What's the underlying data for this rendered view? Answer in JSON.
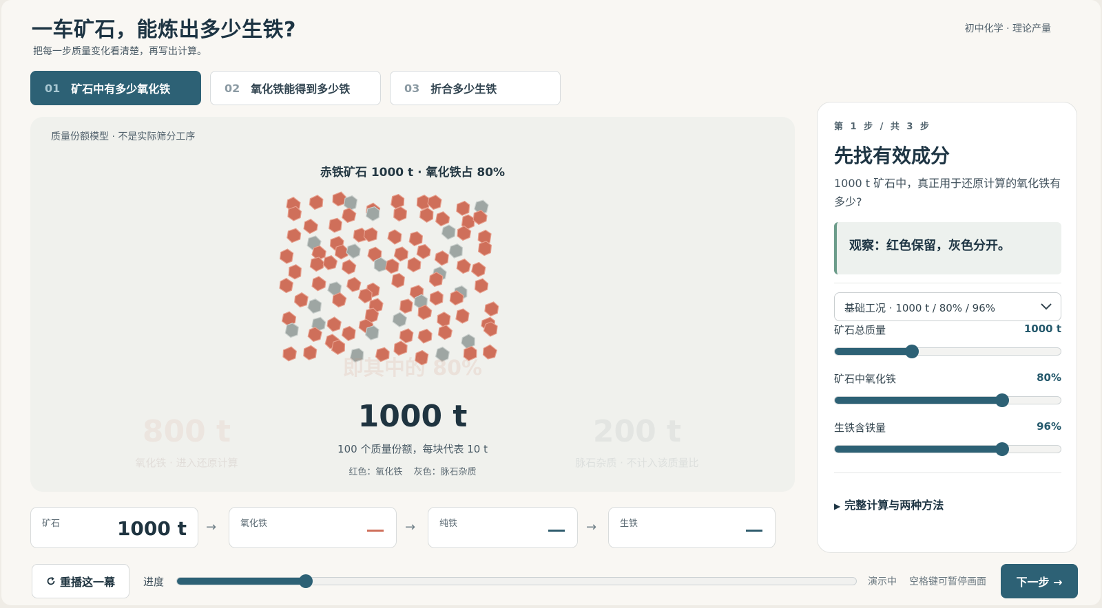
{
  "header": {
    "title": "一车矿石，能炼出多少生铁?",
    "subtitle": "把每一步质量变化看清楚，再写出计算。",
    "topic": "初中化学 · 理论产量"
  },
  "tabs": [
    {
      "num": "01",
      "label": "矿石中有多少氧化铁",
      "active": true
    },
    {
      "num": "02",
      "label": "氧化铁能得到多少铁",
      "active": false
    },
    {
      "num": "03",
      "label": "折合多少生铁",
      "active": false
    }
  ],
  "stage": {
    "note": "质量份额模型 · 不是实际筛分工序",
    "ore_title": "赤铁矿石 1000 t · 氧化铁占 80%",
    "ghost_center": "即其中的 80%",
    "total": "1000 t",
    "total_desc": "100 个质量份额，每块代表 10 t",
    "legend_red": "红色：氧化铁",
    "legend_gray": "灰色：脉石杂质",
    "left_ghost_value": "800 t",
    "left_ghost_label": "氧化铁 · 进入还原计算",
    "right_ghost_value": "200 t",
    "right_ghost_label": "脉石杂质 · 不计入该质量比",
    "colors": {
      "fe2o3": "#cf6f5a",
      "gangue": "#9ea6a3"
    }
  },
  "flow": [
    {
      "label": "矿石",
      "value": "1000 t"
    },
    {
      "label": "氧化铁",
      "value": ""
    },
    {
      "label": "纯铁",
      "value": ""
    },
    {
      "label": "生铁",
      "value": ""
    }
  ],
  "flow_arrow": "→",
  "panel": {
    "step_of": "第 1 步 / 共 3 步",
    "heading": "先找有效成分",
    "body": "1000 t 矿石中，真正用于还原计算的氧化铁有多少?",
    "observe": "观察：红色保留，灰色分开。",
    "preset": "基础工况 · 1000 t / 80% / 96%",
    "sliders": [
      {
        "name": "矿石总质量",
        "value": "1000 t",
        "level": 0.34
      },
      {
        "name": "矿石中氧化铁",
        "value": "80%",
        "level": 0.74
      },
      {
        "name": "生铁含铁量",
        "value": "96%",
        "level": 0.74
      }
    ],
    "details": "完整计算与两种方法"
  },
  "controls": {
    "replay": "重播这一幕",
    "progress_label": "进度",
    "progress": 0.19,
    "playing": "演示中",
    "space_hint": "空格键可暂停画面",
    "next": "下一步 →"
  },
  "icons": {
    "replay": "replay-icon",
    "chevron": "chevron-down-icon",
    "details": "triangle-right-icon"
  }
}
